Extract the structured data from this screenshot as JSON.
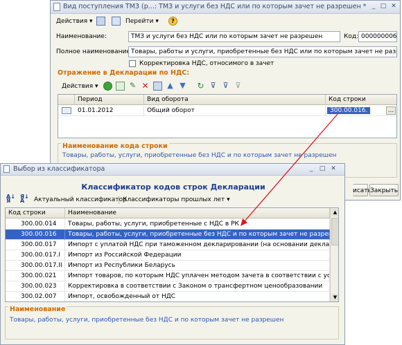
{
  "doc_window": {
    "title": "Вид поступления ТМЗ (р...: ТМЗ и услуги без НДС или по которым зачет не разрешен *",
    "toolbar": {
      "actions": "Действия",
      "goto": "Перейти",
      "help": "?"
    },
    "name_label": "Наименование:",
    "name_value": "ТМЗ и услуги без НДС или по которым зачет не разрешен",
    "code_label": "Код:",
    "code_value": "000000006",
    "fullname_label": "Полное наименование:",
    "fullname_value": "Товары, работы и услуги, приобретенные без НДС или по которым зачет не разрешен",
    "checkbox_label": "Корректировка НДС, относимого в зачет",
    "section_title": "Отражение в Декларации по НДС:",
    "grid_toolbar": {
      "actions": "Действия"
    },
    "grid": {
      "columns": [
        "",
        "Период",
        "Вид оборота",
        "Код строки"
      ],
      "rows": [
        {
          "period": "01.01.2012",
          "turnover": "Общий оборот",
          "code": "300.00.016.",
          "more": "..."
        }
      ]
    },
    "line_name_title": "Наименование кода строки",
    "line_name_value": "Товары, работы, услуги, приобретенные без НДС и по которым зачет не разрешен",
    "buttons": {
      "write": "исать",
      "close": "Закрыть"
    }
  },
  "classifier_window": {
    "title": "Выбор из классификатора",
    "heading": "Классификатор кодов строк Декларации",
    "toolbar": {
      "current": "Актуальный классификатор",
      "past": "Классификаторы прошлых лет"
    },
    "columns": [
      "Код строки",
      "Наименование"
    ],
    "rows": [
      {
        "code": "300.00.014",
        "name": "Товары, работы, услуги, приобретенные с НДС в РК"
      },
      {
        "code": "300.00.016",
        "name": "Товары, работы, услуги, приобретенные без НДС и по которым зачет не разрешен"
      },
      {
        "code": "300.00.017",
        "name": "Импорт с уплатой НДС при таможенном декларировании (на основании декларации на ..."
      },
      {
        "code": "300.00.017.I",
        "name": "Импорт  из Российской Федерации"
      },
      {
        "code": "300.00.017.II",
        "name": "Импорт из Республики Беларусь"
      },
      {
        "code": "300.00.021",
        "name": "Импорт товаров, по которым НДС уплачен методом зачета в соответствии с условиями..."
      },
      {
        "code": "300.00.023",
        "name": "Корректировка в соответствии с Законом о трансфертном ценообразовании"
      },
      {
        "code": "300.02.007",
        "name": "Импорт, освобожденный от НДС"
      }
    ],
    "selected_index": 1,
    "name_section_title": "Наименование",
    "name_value": "Товары, работы, услуги, приобретенные без НДС и по которым зачет не разрешен"
  },
  "colors": {
    "selection": "#3463c3",
    "section_orange": "#d16a00",
    "arrow": "#e0141e",
    "heading_blue": "#1d3d8f"
  }
}
